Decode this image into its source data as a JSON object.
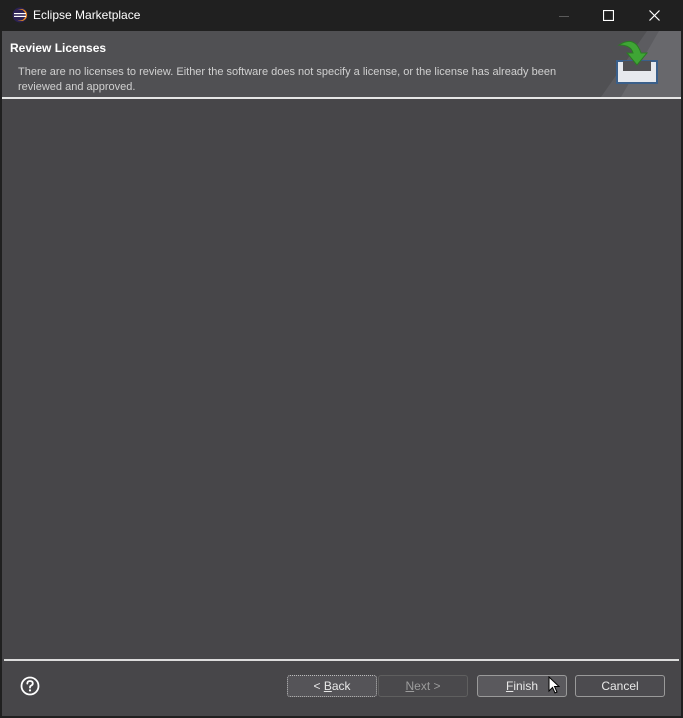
{
  "window": {
    "title": "Eclipse Marketplace",
    "controls": {
      "minimize": "minimize-icon",
      "maximize": "maximize-icon",
      "close": "close-icon"
    }
  },
  "banner": {
    "title": "Review Licenses",
    "description": "There are no licenses to review.  Either the software does not specify a license, or the license has already been reviewed and approved.",
    "graphic": "install-download-icon"
  },
  "footer": {
    "help_icon": "help-icon",
    "buttons": {
      "back": {
        "prefix": "< ",
        "mnemonic": "B",
        "rest": "ack",
        "enabled": true
      },
      "next": {
        "mnemonic": "N",
        "rest": "ext >",
        "enabled": false
      },
      "finish": {
        "mnemonic": "F",
        "rest": "inish",
        "enabled": true
      },
      "cancel": {
        "label": "Cancel",
        "enabled": true
      }
    }
  },
  "colors": {
    "titlebar": "#202020",
    "content": "#474649",
    "banner": "#505053",
    "accent_green": "#3fa535"
  }
}
